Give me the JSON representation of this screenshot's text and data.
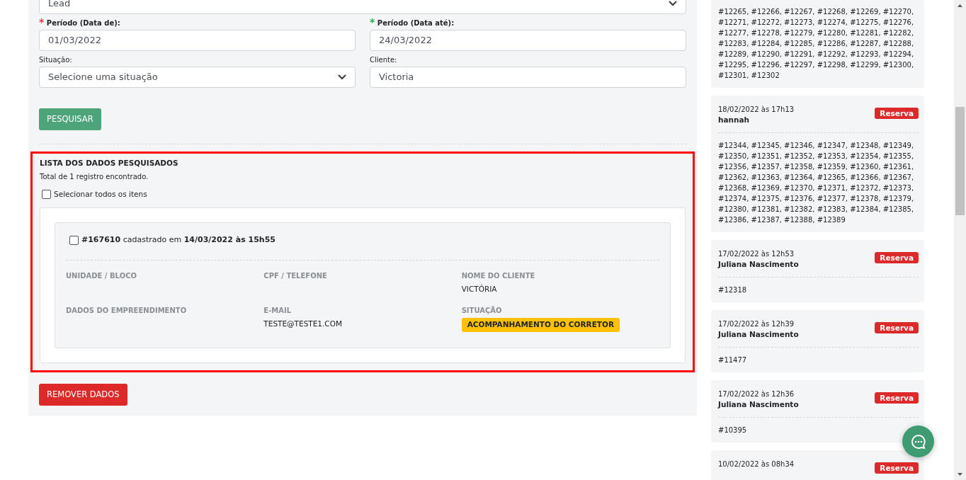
{
  "filters": {
    "top_select": {
      "value": "Lead"
    },
    "fields": [
      {
        "kind": "input",
        "label": "Período (Data de):",
        "required": true,
        "required_mark": "*",
        "color": "#dc3545",
        "value": "01/03/2022"
      },
      {
        "kind": "input",
        "label": "Período (Data até):",
        "required": true,
        "required_mark": "*",
        "color": "#28a745",
        "value": "24/03/2022"
      },
      {
        "kind": "select",
        "label": "Situação:",
        "required": false,
        "value": "Selecione uma situação"
      },
      {
        "kind": "input",
        "label": "Cliente:",
        "required": false,
        "value": "Victoria"
      }
    ],
    "search_button": "PESQUISAR"
  },
  "results": {
    "highlighted": true,
    "title": "LISTA DOS DADOS PESQUISADOS",
    "total": "Total de 1 registro encontrado.",
    "select_all": {
      "label": "Selecionar todos os itens",
      "checked": false
    },
    "records": [
      {
        "checked": false,
        "heading": "**#167610** cadastrado em **14/03/2022 às 15h55**",
        "fields": [
          {
            "kind": "text",
            "label": "UNIDADE / BLOCO"
          },
          {
            "kind": "text",
            "label": "CPF / TELEFONE"
          },
          {
            "kind": "text",
            "label": "NOME DO CLIENTE",
            "value": "VICTÓRIA"
          },
          {
            "kind": "text",
            "label": "DADOS DO EMPREENDIMENTO"
          },
          {
            "kind": "text",
            "label": "E-MAIL",
            "value": "TESTE@TESTE1.COM"
          },
          {
            "kind": "badge",
            "label": "SITUAÇÃO",
            "value": "ACOMPANHAMENTO DO CORRETOR"
          }
        ]
      }
    ],
    "remove_button": "REMOVER DADOS"
  },
  "sidebar": {
    "cards": [
      {
        "codes": "#12265, #12266, #12267, #12268, #12269, #12270, #12271, #12272, #12273, #12274, #12275, #12276, #12277, #12278, #12279, #12280, #12281, #12282, #12283, #12284, #12285, #12286, #12287, #12288, #12289, #12290, #12291, #12292, #12293, #12294, #12295, #12296, #12297, #12298, #12299, #12300, #12301, #12302"
      },
      {
        "time": "18/02/2022 às 17h13",
        "name": "hannah",
        "tag": "Reserva",
        "codes": "#12344, #12345, #12346, #12347, #12348, #12349, #12350, #12351, #12352, #12353, #12354, #12355, #12356, #12357, #12358, #12359, #12360, #12361, #12362, #12363, #12364, #12365, #12366, #12367, #12368, #12369, #12370, #12371, #12372, #12373, #12374, #12375, #12376, #12377, #12378, #12379, #12380, #12381, #12382, #12383, #12384, #12385, #12386, #12387, #12388, #12389"
      },
      {
        "time": "17/02/2022 às 12h53",
        "name": "Juliana Nascimento",
        "tag": "Reserva",
        "codes": "#12318"
      },
      {
        "time": "17/02/2022 às 12h39",
        "name": "Juliana Nascimento",
        "tag": "Reserva",
        "codes": "#11477"
      },
      {
        "time": "17/02/2022 às 12h36",
        "name": "Juliana Nascimento",
        "tag": "Reserva",
        "codes": "#10395"
      },
      {
        "time": "10/02/2022 às 08h34",
        "tag": "Reserva"
      }
    ]
  }
}
